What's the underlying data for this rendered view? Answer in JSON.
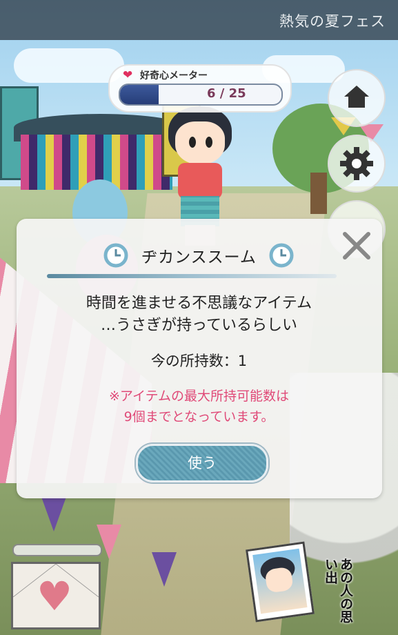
{
  "event": {
    "title": "熱気の夏フェス"
  },
  "meter": {
    "label": "好奇心メーター",
    "current": 6,
    "max": 25,
    "count_text": "6 / 25"
  },
  "dialog": {
    "title": "ヂカンススーム",
    "description_line1": "時間を進ませる不思議なアイテム",
    "description_line2": "…うさぎが持っているらしい",
    "count_text": "今の所持数：1",
    "note_line1": "※アイテムの最大所持可能数は",
    "note_line2": "9個までとなっています。",
    "use_label": "使う"
  },
  "memories": {
    "label": "あの人の思い出"
  },
  "icons": {
    "home": "home-icon",
    "settings": "gear-icon",
    "close": "close-icon",
    "clock": "clock-icon",
    "letter": "letter-icon",
    "heart": "heart-icon"
  },
  "colors": {
    "accent": "#5a98ae",
    "note": "#e04a78",
    "meter_fill": "#263d78"
  }
}
